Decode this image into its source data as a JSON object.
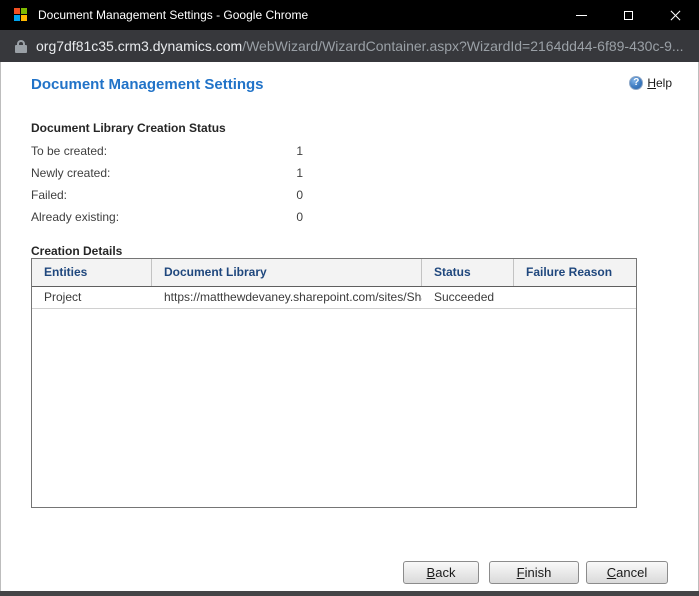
{
  "window": {
    "title": "Document Management Settings - Google Chrome"
  },
  "icons": {
    "favicon": "microsoft-four-squares-logo",
    "favicon_colors": {
      "red": "#F25022",
      "green": "#7FBA00",
      "blue": "#00A4EF",
      "yellow": "#FFB900"
    },
    "minimize": "minimize-line",
    "maximize": "maximize-square",
    "close": "close-x",
    "lock": "padlock",
    "help_glyph": "?"
  },
  "urlbar": {
    "domain": "org7df81c35.crm3.dynamics.com",
    "path": "/WebWizard/WizardContainer.aspx?WizardId=2164dd44-6f89-430c-9..."
  },
  "page": {
    "title": "Document Management Settings",
    "help_key": "H",
    "help_rest": "elp"
  },
  "status_section": {
    "heading": "Document Library Creation Status",
    "items": [
      {
        "label": "To be created:",
        "value": "1"
      },
      {
        "label": "Newly created:",
        "value": "1"
      },
      {
        "label": "Failed:",
        "value": "0"
      },
      {
        "label": "Already existing:",
        "value": "0"
      }
    ]
  },
  "details_section": {
    "heading": "Creation Details",
    "columns": [
      "Entities",
      "Document Library",
      "Status",
      "Failure Reason"
    ],
    "rows": [
      {
        "entity": "Project",
        "library": "https://matthewdevaney.sharepoint.com/sites/Shar...",
        "status": "Succeeded",
        "failure_reason": ""
      }
    ]
  },
  "footer": {
    "buttons": [
      {
        "key": "B",
        "rest": "ack"
      },
      {
        "key": "F",
        "rest": "inish"
      },
      {
        "key": "C",
        "rest": "ancel"
      }
    ]
  },
  "colors": {
    "page_title_blue": "#2173C8",
    "table_header_navy": "#1F477D",
    "titlebar_black": "#000000",
    "urlbar_gray": "#37383C"
  }
}
